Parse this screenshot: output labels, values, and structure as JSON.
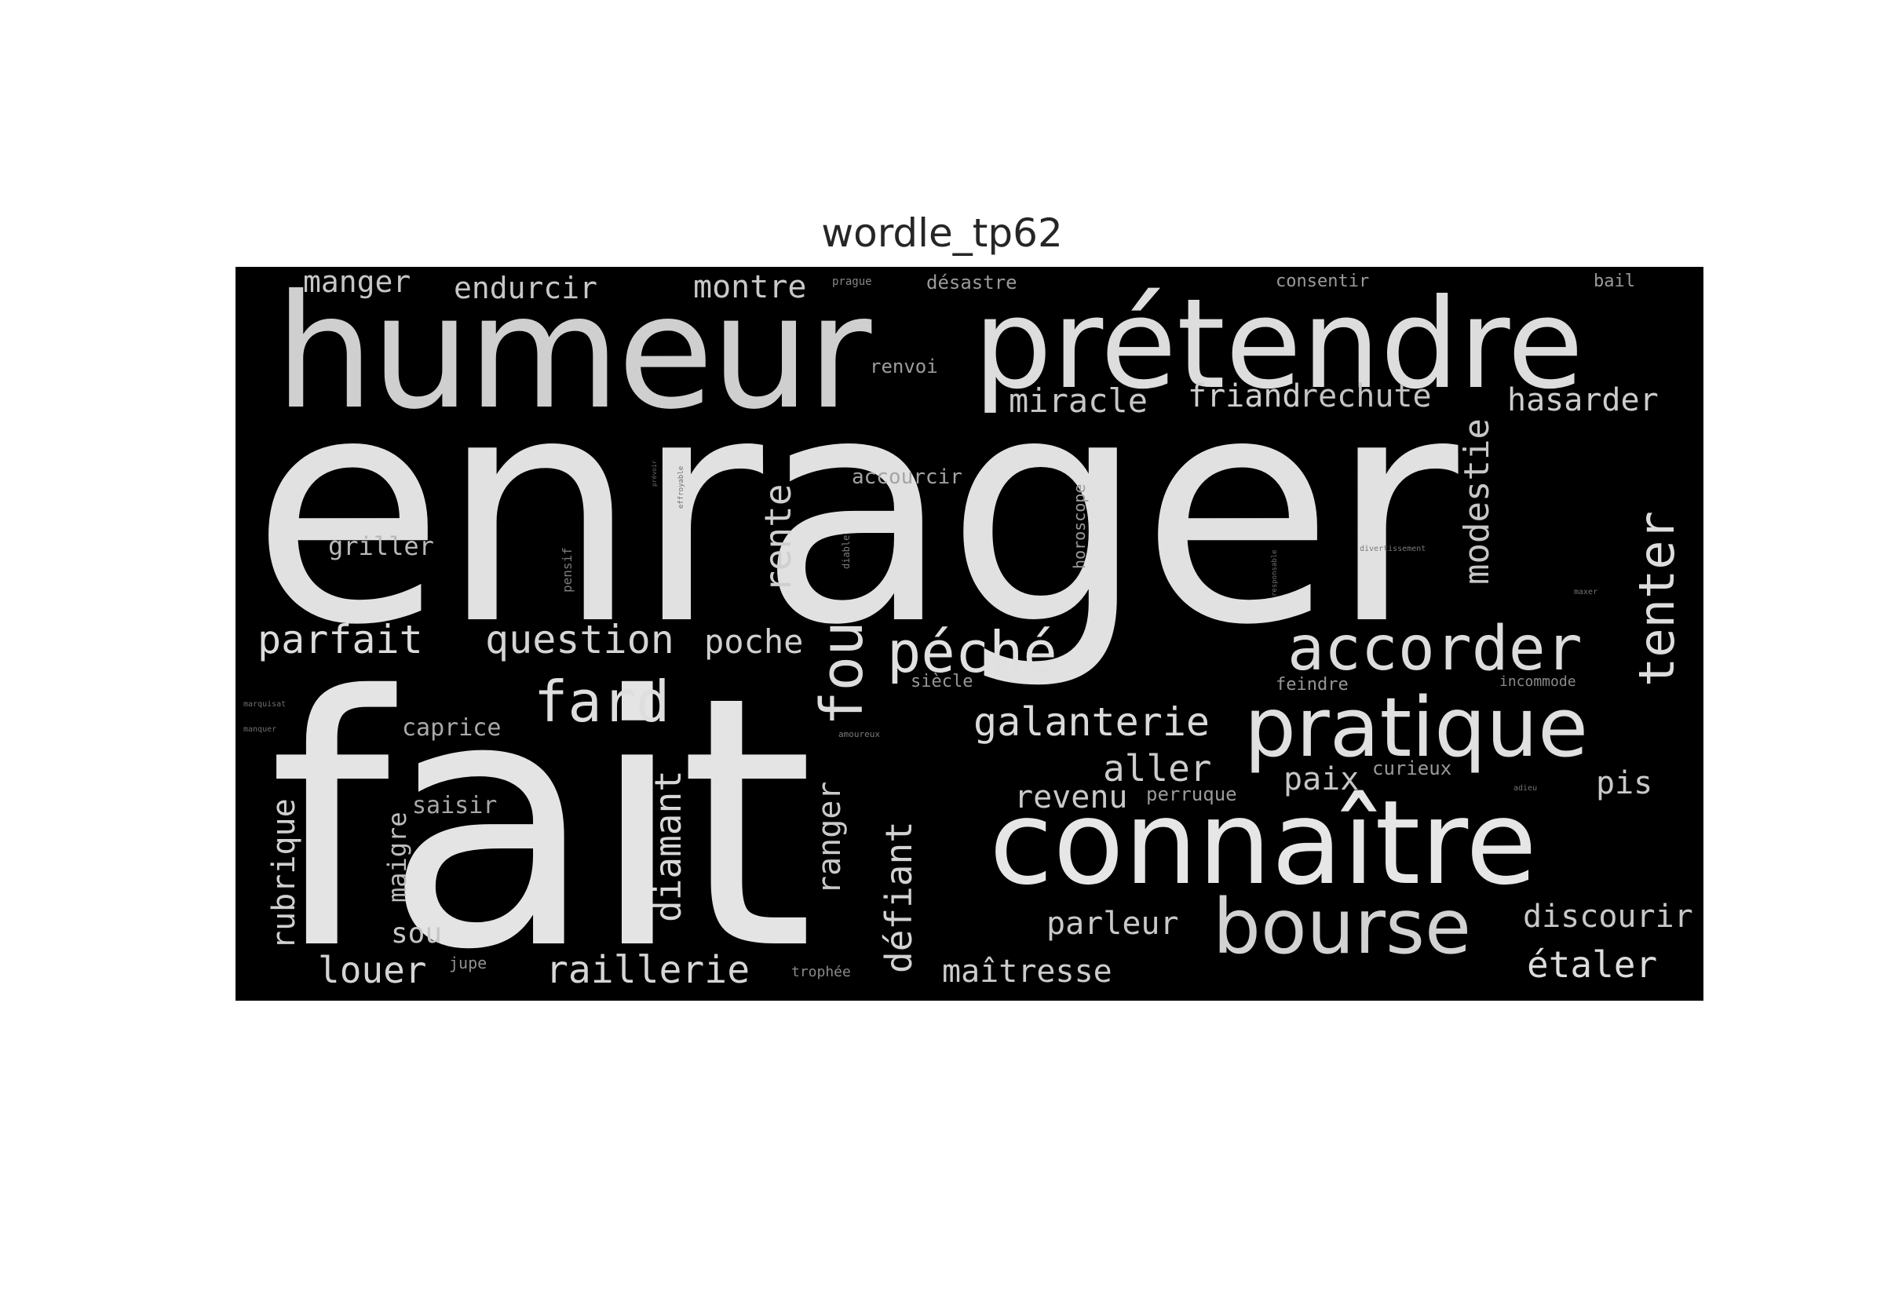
{
  "title": "wordle_tp62",
  "colors": {
    "background": "#000000",
    "word_bright": "#e4e4e4",
    "word_mid": "#bdbdbd",
    "word_dim": "#8a8a8a"
  },
  "words": {
    "enrager": "enrager",
    "fait": "fait",
    "humeur": "humeur",
    "pretendre": "prétendre",
    "connaitre": "connaître",
    "pratique": "pratique",
    "bourse": "bourse",
    "accorder": "accorder",
    "fou": "fou",
    "peche": "péché",
    "tenter": "tenter",
    "fard": "fard",
    "parfait": "parfait",
    "question": "question",
    "modestie": "modestie",
    "rente": "rente",
    "diamant": "diamant",
    "defiant": "défiant",
    "galanterie": "galanterie",
    "raillerie": "raillerie",
    "louer": "louer",
    "etaler": "étaler",
    "rubrique": "rubrique",
    "ranger": "ranger",
    "aller": "aller",
    "poche": "poche",
    "miracle": "miracle",
    "friand": "friand",
    "rechute": "rechute",
    "hasarder": "hasarder",
    "discourir": "discourir",
    "parleur": "parleur",
    "maitresse": "maîtresse",
    "revenu": "revenu",
    "montre": "montre",
    "endurcir": "endurcir",
    "manger": "manger",
    "paix": "paix",
    "pis": "pis",
    "sou": "sou",
    "maigre": "maigre",
    "griller": "griller",
    "caprice": "caprice",
    "saisir": "saisir",
    "accourcir": "accourcir",
    "horoscope": "horoscope",
    "renvoi": "renvoi",
    "desastre": "désastre",
    "consentir": "consentir",
    "bail": "bail",
    "curieux": "curieux",
    "perruque": "perruque",
    "siecle": "siècle",
    "feindre": "feindre",
    "incommode": "incommode",
    "jupe": "jupe",
    "trophee": "trophée",
    "amoureux": "amoureux",
    "pensif": "pensif",
    "diable": "diable",
    "prague": "prague",
    "effroyable": "effroyable",
    "prevoir": "prévoir",
    "divertissement": "divertissement",
    "responsable": "responsable",
    "marquisat": "marquisat",
    "manquer": "manquer",
    "adieu": "adieu",
    "maxer": "maxer"
  }
}
